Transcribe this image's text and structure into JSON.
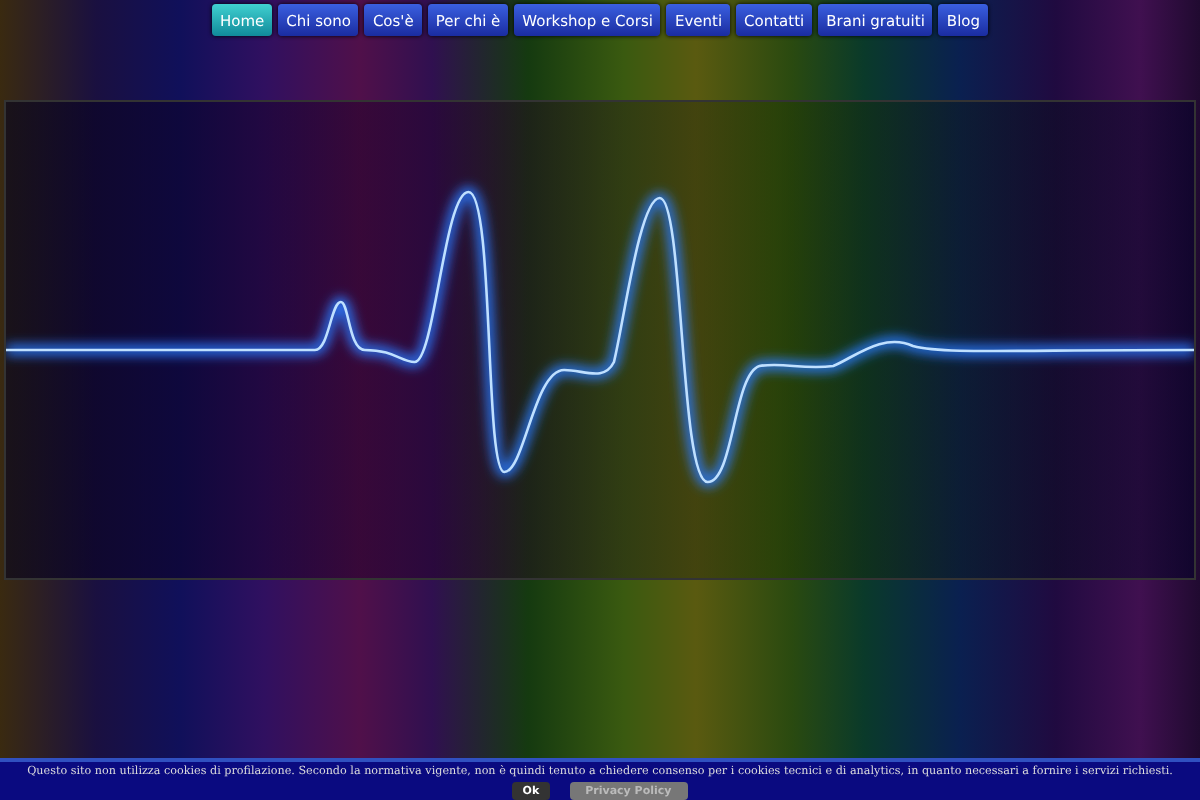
{
  "nav": {
    "items": [
      {
        "label": "Home",
        "selected": true
      },
      {
        "label": "Chi sono",
        "selected": false
      },
      {
        "label": "Cos'è",
        "selected": false
      },
      {
        "label": "Per chi è",
        "selected": false
      },
      {
        "label": "Workshop e Corsi",
        "selected": false
      },
      {
        "label": "Eventi",
        "selected": false
      },
      {
        "label": "Contatti",
        "selected": false
      },
      {
        "label": "Brani gratuiti",
        "selected": false
      },
      {
        "label": "Blog",
        "selected": false
      }
    ]
  },
  "cookie_bar": {
    "text": "Questo sito non utilizza cookies di profilazione. Secondo la normativa vigente, non è quindi tenuto a chiedere consenso per i cookies tecnici e di analytics, in quanto necessari a fornire i servizi richiesti.",
    "buttons": [
      {
        "label": "Ok",
        "kind": "accept"
      },
      {
        "label": "Privacy Policy",
        "kind": "policy"
      }
    ]
  }
}
